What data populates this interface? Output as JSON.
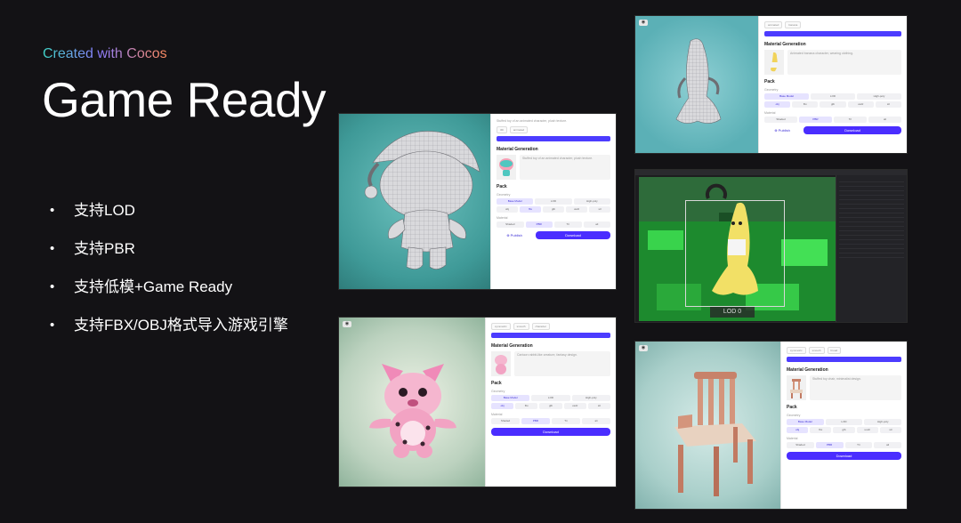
{
  "header": {
    "kicker": "Created with Cocos",
    "title": "Game Ready"
  },
  "bullets": [
    "支持LOD",
    "支持PBR",
    "支持低模+Game Ready",
    "支持FBX/OBJ格式导入游戏引擎"
  ],
  "card_main": {
    "prompt_top": "Stuffed toy of an animated character, plush texture.",
    "section_material": "Material Generation",
    "prompt": "Stuffed toy of an animated character, plush texture.",
    "section_pack": "Pack",
    "geometry_label": "Geometry",
    "geometry_options": [
      "Base Model",
      "LOD",
      "High-poly"
    ],
    "format_options": [
      "obj",
      "fbx",
      "glb",
      "usdz",
      "stl"
    ],
    "material_label": "Material",
    "material_options": [
      "Shaded",
      "PBR",
      "Tri",
      "ali"
    ],
    "publish": "Publish",
    "download": "Download"
  },
  "card_banana": {
    "section_material": "Material Generation",
    "prompt": "Animated banana character, wearing clothing.",
    "section_pack": "Pack",
    "geometry_label": "Geometry",
    "geometry_options": [
      "Base Model",
      "LOD",
      "High-poly"
    ],
    "format_options": [
      "obj",
      "fbx",
      "glb",
      "usdz",
      "stl"
    ],
    "material_label": "Material",
    "material_options": [
      "Shaded",
      "PBR",
      "Tri",
      "ali"
    ],
    "publish": "Publish",
    "download": "Download"
  },
  "card_cat": {
    "section_material": "Material Generation",
    "prompt": "Cartoon rabbit-like creature, fantasy design.",
    "section_pack": "Pack",
    "geometry_label": "Geometry",
    "geometry_options": [
      "Base Model",
      "LOD",
      "High-poly"
    ],
    "format_options": [
      "obj",
      "fbx",
      "glb",
      "usdz",
      "stl"
    ],
    "material_label": "Material",
    "material_options": [
      "Shaded",
      "PBR",
      "Tri",
      "ali"
    ],
    "download": "Download"
  },
  "card_chair": {
    "section_material": "Material Generation",
    "prompt": "Stuffed toy chair, minimalist design.",
    "section_pack": "Pack",
    "geometry_label": "Geometry",
    "geometry_options": [
      "Base Model",
      "LOD",
      "High-poly"
    ],
    "format_options": [
      "obj",
      "fbx",
      "glb",
      "usdz",
      "stl"
    ],
    "material_label": "Material",
    "material_options": [
      "Shaded",
      "PBR",
      "Tri",
      "ali"
    ],
    "download": "Download"
  },
  "editor": {
    "lod_label": "LOD 0"
  },
  "colors": {
    "accent": "#4a2dff",
    "background": "#131215"
  }
}
